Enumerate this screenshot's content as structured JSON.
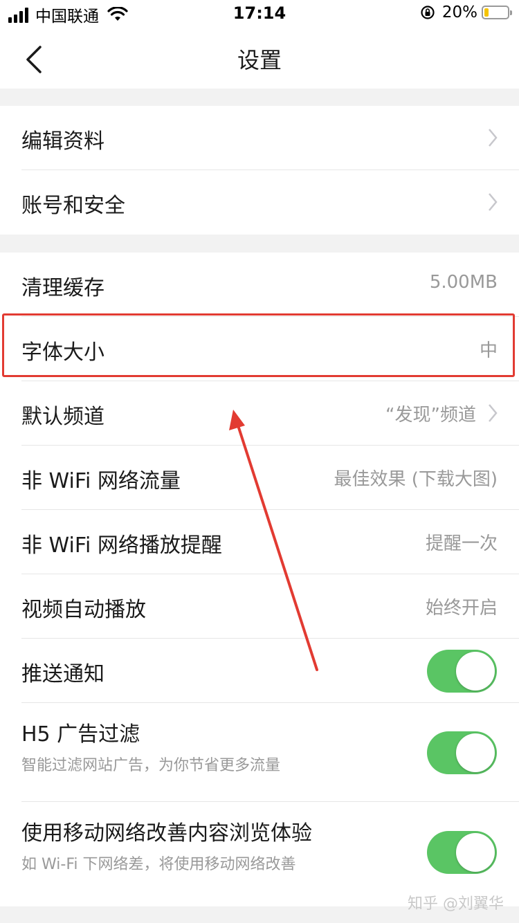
{
  "status": {
    "carrier": "中国联通",
    "time": "17:14",
    "battery_pct": "20%",
    "battery_level": 0.2
  },
  "nav": {
    "title": "设置"
  },
  "groups": [
    {
      "items": [
        {
          "label": "编辑资料",
          "chevron": true
        },
        {
          "label": "账号和安全",
          "chevron": true
        }
      ]
    },
    {
      "items": [
        {
          "label": "清理缓存",
          "value": "5.00MB"
        },
        {
          "label": "字体大小",
          "value": "中"
        },
        {
          "label": "默认频道",
          "value": "“发现”频道",
          "chevron": true
        },
        {
          "label": "非 WiFi 网络流量",
          "value": "最佳效果 (下载大图)"
        },
        {
          "label": "非 WiFi 网络播放提醒",
          "value": "提醒一次"
        },
        {
          "label": "视频自动播放",
          "value": "始终开启"
        },
        {
          "label": "推送通知",
          "toggle": true
        },
        {
          "label": "H5 广告过滤",
          "sub": "智能过滤网站广告，为你节省更多流量",
          "toggle": true
        },
        {
          "label": "使用移动网络改善内容浏览体验",
          "sub": "如 Wi-Fi 下网络差，将使用移动网络改善",
          "toggle": true
        }
      ]
    }
  ],
  "watermark": "知乎 @刘翼华",
  "colors": {
    "toggle_on": "#5ac564",
    "highlight": "#e23b32",
    "battery": "#f5c400"
  }
}
